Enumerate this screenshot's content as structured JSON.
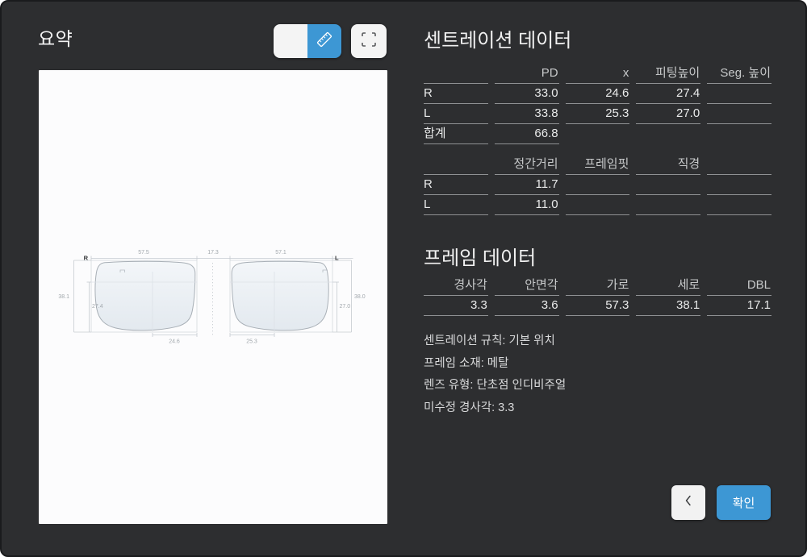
{
  "window": {
    "title": "요약"
  },
  "toolbar": {
    "toggle_left_icon": "blank-option",
    "toggle_right_icon": "ruler-icon",
    "expand_icon": "expand-icon"
  },
  "centration": {
    "heading": "센트레이션 데이터",
    "t1": {
      "h": [
        "",
        "PD",
        "x",
        "피팅높이",
        "Seg. 높이"
      ],
      "r1": [
        "R",
        "33.0",
        "24.6",
        "27.4",
        ""
      ],
      "r2": [
        "L",
        "33.8",
        "25.3",
        "27.0",
        ""
      ],
      "r3": [
        "합계",
        "66.8"
      ]
    },
    "t2": {
      "h": [
        "",
        "정간거리",
        "프레임핏",
        "직경",
        ""
      ],
      "r1": [
        "R",
        "11.7",
        "",
        "",
        ""
      ],
      "r2": [
        "L",
        "11.0",
        "",
        "",
        ""
      ]
    }
  },
  "frame": {
    "heading": "프레임 데이터",
    "t3": {
      "h": [
        "경사각",
        "안면각",
        "가로",
        "세로",
        "DBL"
      ],
      "r1": [
        "3.3",
        "3.6",
        "57.3",
        "38.1",
        "17.1"
      ]
    },
    "notes": [
      "센트레이션 규칙: 기본 위치",
      "프레임 소재: 메탈",
      "렌즈 유형: 단초점 인디비주얼",
      "미수정 경사각: 3.3"
    ]
  },
  "diagram": {
    "label_r": "R",
    "label_l": "L",
    "r_width": "57.5",
    "bridge": "17.3",
    "l_width": "57.1",
    "r_height": "38.1",
    "l_height": "38.0",
    "r_fit": "27.4",
    "l_fit": "27.0",
    "r_x": "24.6",
    "l_x": "25.3"
  },
  "footer": {
    "confirm": "확인"
  },
  "colors": {
    "accent": "#3d97d4",
    "background": "#2d2e30",
    "panel": "#fcfcfd"
  }
}
